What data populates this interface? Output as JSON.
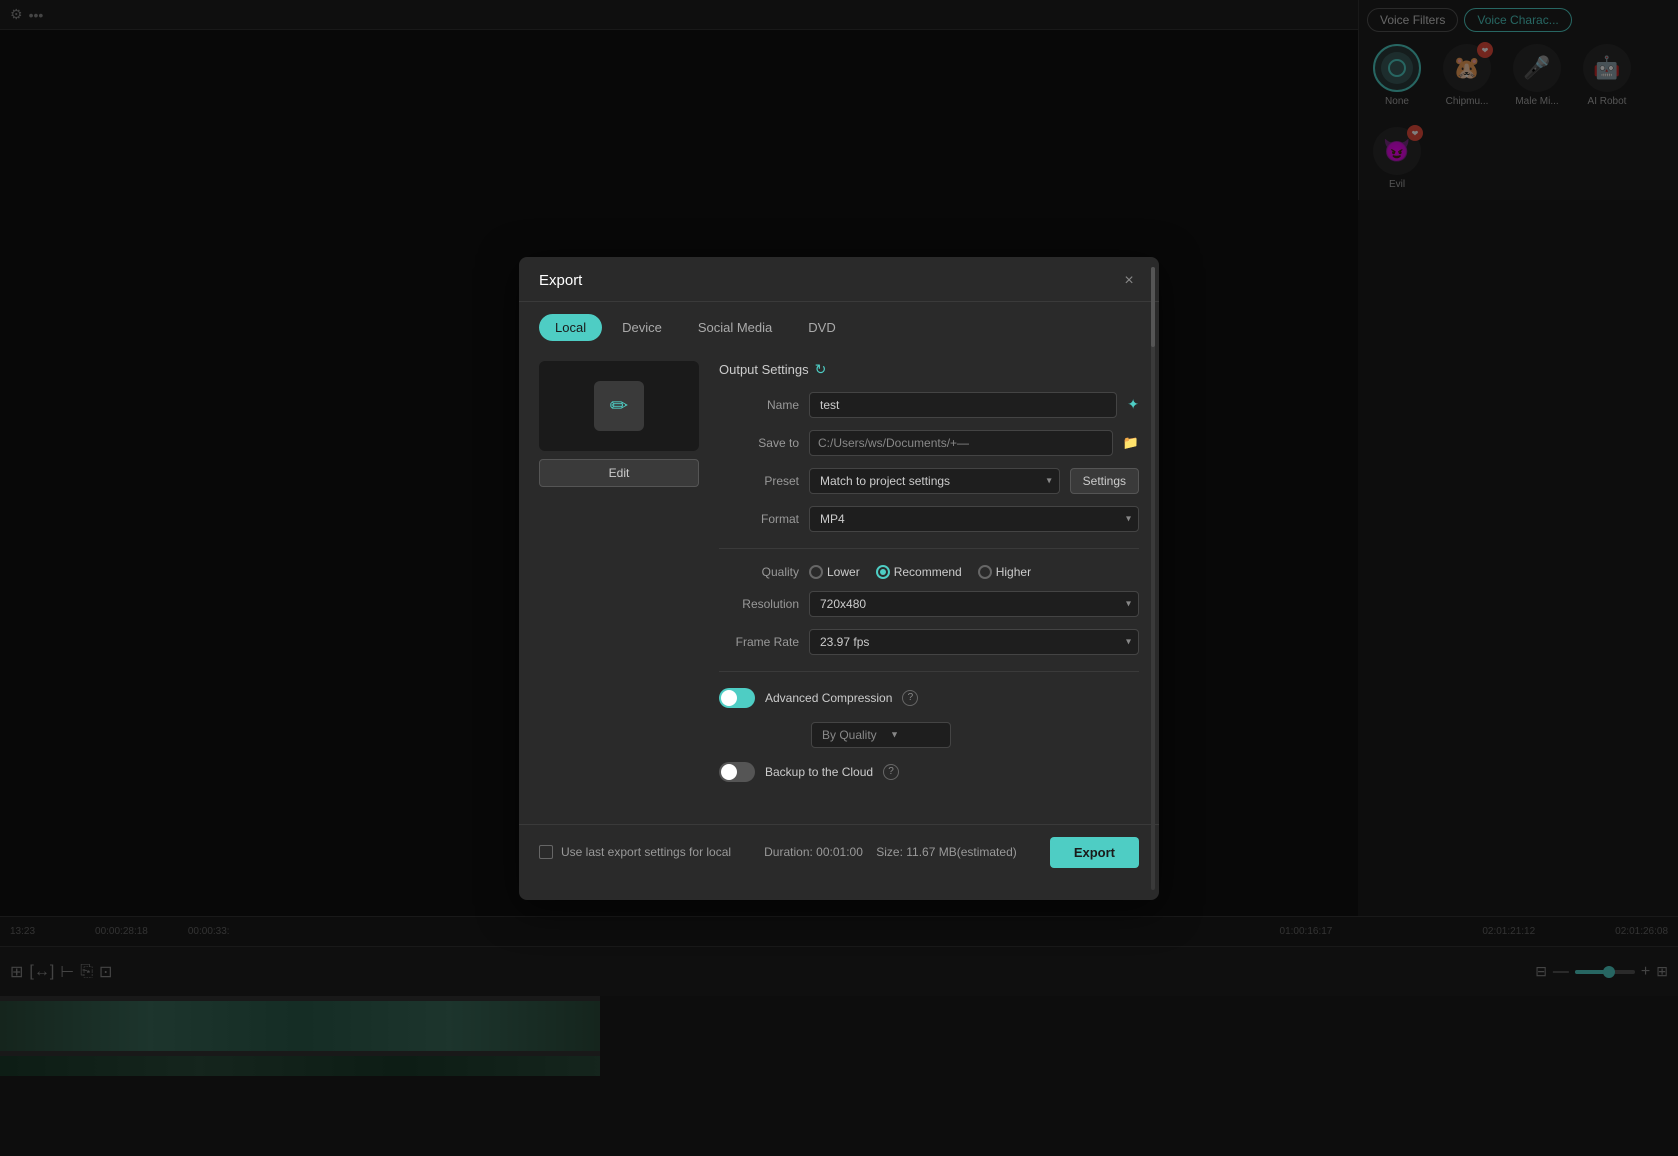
{
  "app": {
    "background_color": "#1a1a1a"
  },
  "top_right_panel": {
    "voice_filters_tab": "Voice Filters",
    "voice_characters_tab": "Voice Charac...",
    "characters": [
      {
        "id": "none",
        "label": "None",
        "emoji": "🔴",
        "selected": true,
        "has_heart": false
      },
      {
        "id": "chipmu",
        "label": "Chipmu...",
        "emoji": "🐭",
        "selected": false,
        "has_heart": true
      },
      {
        "id": "malemi",
        "label": "Male Mi...",
        "emoji": "🎤",
        "selected": false,
        "has_heart": false
      },
      {
        "id": "airobot",
        "label": "AI Robot",
        "emoji": "🤖",
        "selected": false,
        "has_heart": false
      },
      {
        "id": "evil",
        "label": "Evil",
        "emoji": "😈",
        "selected": false,
        "has_heart": true
      }
    ]
  },
  "export_dialog": {
    "title": "Export",
    "close_label": "×",
    "tabs": [
      {
        "id": "local",
        "label": "Local",
        "active": true
      },
      {
        "id": "device",
        "label": "Device",
        "active": false
      },
      {
        "id": "social_media",
        "label": "Social Media",
        "active": false
      },
      {
        "id": "dvd",
        "label": "DVD",
        "active": false
      }
    ],
    "output_settings_label": "Output Settings",
    "name_label": "Name",
    "name_value": "test",
    "save_to_label": "Save to",
    "save_to_path": "C:/Users/ws/Documents/+—",
    "preset_label": "Preset",
    "preset_value": "Match to project settings",
    "settings_btn_label": "Settings",
    "format_label": "Format",
    "format_value": "MP4",
    "quality_label": "Quality",
    "quality_options": [
      {
        "id": "lower",
        "label": "Lower",
        "selected": false
      },
      {
        "id": "recommend",
        "label": "Recommend",
        "selected": true
      },
      {
        "id": "higher",
        "label": "Higher",
        "selected": false
      }
    ],
    "resolution_label": "Resolution",
    "resolution_value": "720x480",
    "frame_rate_label": "Frame Rate",
    "frame_rate_value": "23.97 fps",
    "advanced_compression_label": "Advanced Compression",
    "advanced_compression_enabled": true,
    "by_quality_label": "By Quality",
    "backup_cloud_label": "Backup to the Cloud",
    "backup_cloud_enabled": false,
    "use_last_settings_label": "Use last export settings for local",
    "duration_label": "Duration: 00:01:00",
    "size_label": "Size: 11.67 MB(estimated)",
    "export_btn_label": "Export",
    "edit_btn_label": "Edit"
  }
}
